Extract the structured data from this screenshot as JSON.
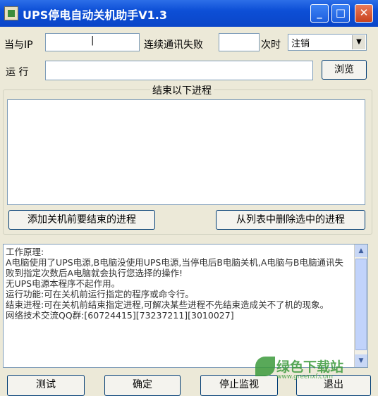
{
  "window": {
    "title": "UPS停电自动关机助手V1.3",
    "minimize": "_",
    "maximize": "□",
    "close": "✕"
  },
  "form": {
    "ip_label": "当与IP",
    "ip_value": "|",
    "fail_label": "连续通讯失败",
    "fail_value": "",
    "times_label": "次时",
    "action_select": "注销",
    "run_label": "运  行",
    "run_value": "",
    "browse_button": "浏览"
  },
  "process_group": {
    "title": "结束以下进程",
    "add_button": "添加关机前要结束的进程",
    "remove_button": "从列表中删除选中的进程"
  },
  "info_lines": [
    "工作原理:",
    "A电脑使用了UPS电源,B电脑没使用UPS电源,当停电后B电脑关机,A电脑与B电脑通讯失败到指定次数后A电脑就会执行您选择的操作!",
    "无UPS电源本程序不起作用。",
    "运行功能:可在关机前运行指定的程序或命令行。",
    "结束进程:可在关机前结束指定进程,可解决某些进程不先结束造成关不了机的现象。",
    "网络技术交流QQ群:[60724415][73237211][3010027]"
  ],
  "bottom_buttons": {
    "test": "测试",
    "ok": "确定",
    "stop": "停止监视",
    "exit": "退出"
  },
  "watermark": {
    "text": "绿色下载站",
    "url": "www.greenxf.com"
  }
}
